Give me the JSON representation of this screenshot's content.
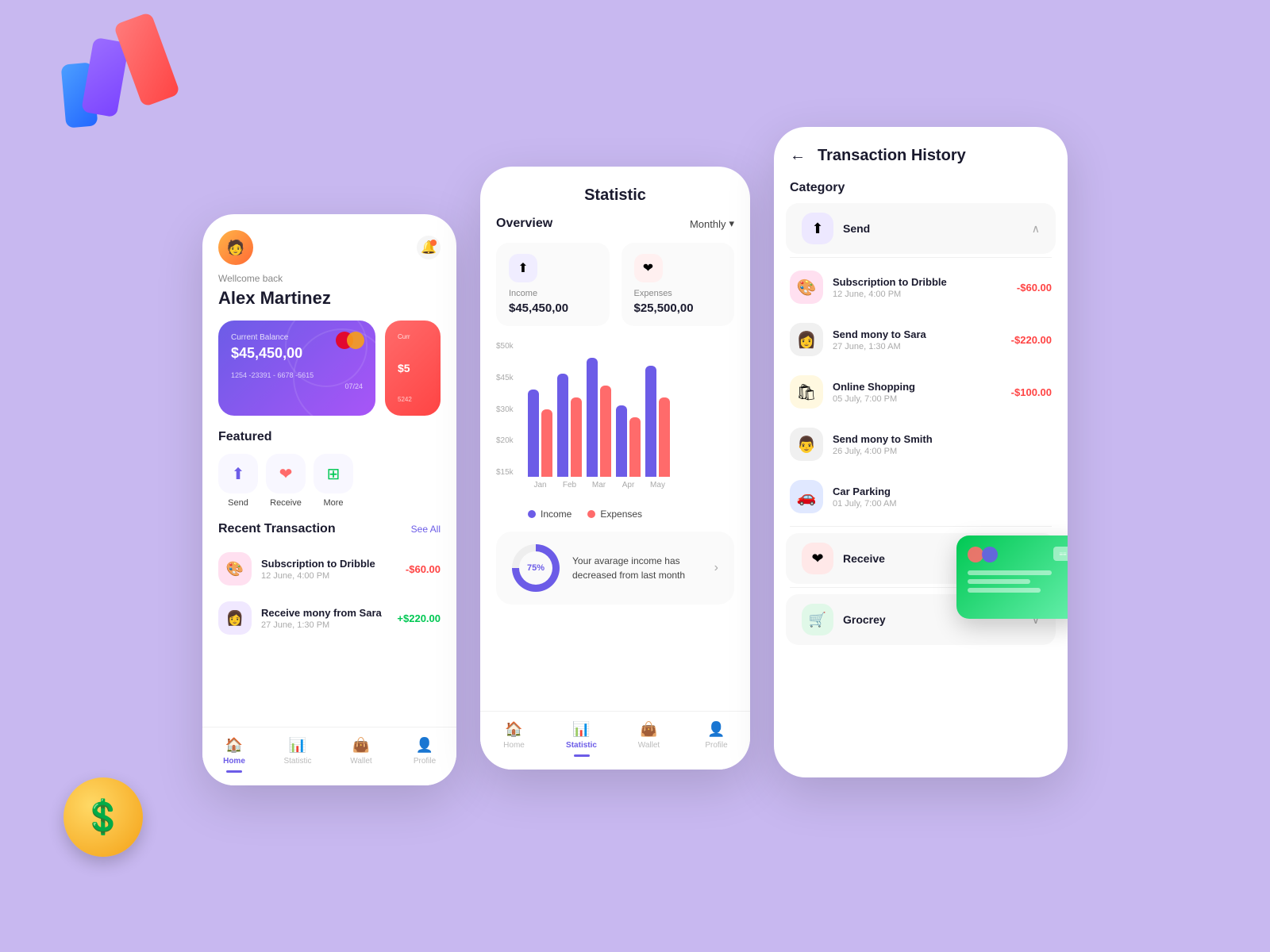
{
  "background": "#c8b8f0",
  "phone1": {
    "welcome": "Wellcome back",
    "username": "Alex Martinez",
    "card": {
      "label": "Current Balance",
      "amount": "$45,450,00",
      "brand": "Mastercard",
      "number": "1254 -23391 - 6678 -5615",
      "expiry": "07/24"
    },
    "card2": {
      "label": "Curr",
      "amount": "$5",
      "number": "5242"
    },
    "featured_title": "Featured",
    "buttons": [
      {
        "label": "Send",
        "icon": "⬆"
      },
      {
        "label": "Receive",
        "icon": "❤"
      },
      {
        "label": "More",
        "icon": "⊞"
      }
    ],
    "recent_title": "Recent Transaction",
    "see_all": "See All",
    "transactions": [
      {
        "name": "Subscription to Dribble",
        "date": "12 June, 4:00 PM",
        "amount": "-$60.00",
        "type": "negative",
        "icon": "🎨"
      },
      {
        "name": "Receive mony from Sara",
        "date": "27 June, 1:30 PM",
        "amount": "+$220.00",
        "type": "positive",
        "icon": "👩"
      }
    ],
    "nav": [
      {
        "label": "Home",
        "icon": "🏠",
        "active": true
      },
      {
        "label": "Statistic",
        "icon": "📊",
        "active": false
      },
      {
        "label": "Wallet",
        "icon": "👜",
        "active": false
      },
      {
        "label": "Profile",
        "icon": "👤",
        "active": false
      }
    ]
  },
  "phone2": {
    "title": "Statistic",
    "overview_label": "Overview",
    "period_label": "Monthly",
    "income": {
      "label": "Income",
      "amount": "$45,450,00"
    },
    "expenses": {
      "label": "Expenses",
      "amount": "$25,500,00"
    },
    "chart": {
      "y_labels": [
        "$50k",
        "$45k",
        "$30k",
        "$20k",
        "$15k"
      ],
      "x_labels": [
        "Jan",
        "Feb",
        "Mar",
        "Apr",
        "May"
      ],
      "income_bars": [
        65,
        80,
        90,
        55,
        85
      ],
      "expense_bars": [
        50,
        60,
        70,
        45,
        60
      ]
    },
    "legend": {
      "income": "Income",
      "expenses": "Expenses"
    },
    "progress": {
      "percent": "75%",
      "description": "Your avarage income has decreased from last month"
    },
    "nav": [
      {
        "label": "Home",
        "icon": "🏠",
        "active": false
      },
      {
        "label": "Statistic",
        "icon": "📊",
        "active": true
      },
      {
        "label": "Wallet",
        "icon": "👜",
        "active": false
      },
      {
        "label": "Profile",
        "icon": "👤",
        "active": false
      }
    ]
  },
  "phone3": {
    "title": "Transaction History",
    "category_label": "Category",
    "send_label": "Send",
    "transactions": [
      {
        "name": "Subscription to Dribble",
        "date": "12 June, 4:00 PM",
        "amount": "-$60.00",
        "icon": "🎨",
        "bg": "#ffe0f0"
      },
      {
        "name": "Send mony to Sara",
        "date": "27 June, 1:30 AM",
        "amount": "-$220.00",
        "icon": "👩",
        "bg": "#f0f0f0"
      },
      {
        "name": "Online Shopping",
        "date": "05 July, 7:00 PM",
        "amount": "-$100.00",
        "icon": "🛍",
        "bg": "#fff8e0"
      },
      {
        "name": "Send mony to Smith",
        "date": "26 July, 4:00 PM",
        "amount": "",
        "icon": "👨",
        "bg": "#f0f0f0"
      },
      {
        "name": "Car Parking",
        "date": "01 July, 7:00 AM",
        "amount": "",
        "icon": "🚗",
        "bg": "#e0e8ff"
      }
    ],
    "receive_label": "Receive",
    "grocery_label": "Grocrey"
  }
}
